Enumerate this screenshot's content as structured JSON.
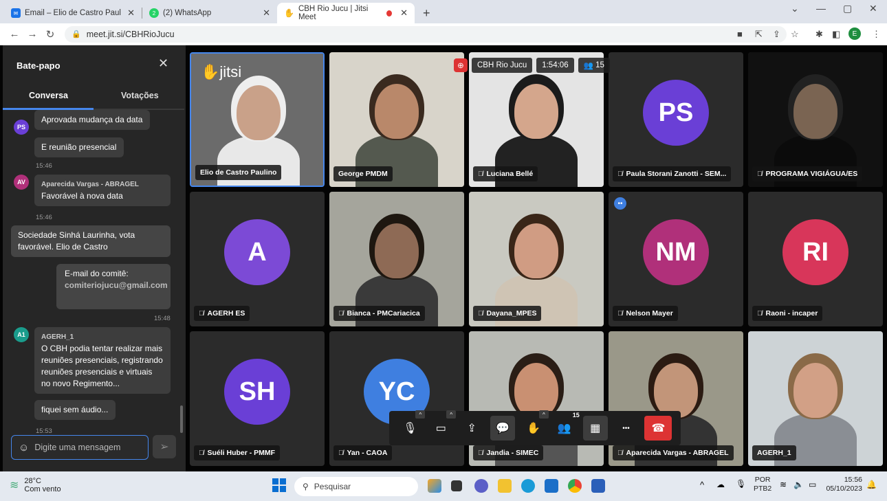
{
  "browser": {
    "tabs": [
      {
        "title": "Email – Elio de Castro Paulino -",
        "icon": "mail-icon"
      },
      {
        "title": "(2) WhatsApp",
        "icon": "whatsapp-icon"
      },
      {
        "title": "CBH Rio Jucu | Jitsi Meet",
        "icon": "jitsi-icon"
      }
    ],
    "url": "meet.jit.si/CBHRioJucu",
    "profile_initial": "E"
  },
  "chat": {
    "title": "Bate-papo",
    "tab_conversation": "Conversa",
    "tab_polls": "Votações",
    "messages": [
      {
        "initials": "PS",
        "text": "Aprovada mudança da data"
      },
      {
        "text": "E reunião presencial",
        "time": "15:46"
      },
      {
        "initials": "AV",
        "sender": "Aparecida Vargas - ABRAGEL",
        "text": "Favorável à nova data",
        "time": "15:46"
      },
      {
        "text": "Sociedade Sinhá Laurinha, vota favorável.  Elio de Castro"
      },
      {
        "text": "E-mail do comitê:",
        "text2": "comiteriojucu@gmail.com",
        "time": "15:48"
      },
      {
        "initials": "A1",
        "sender": "AGERH_1",
        "text": "O CBH podia tentar realizar mais reuniões presenciais, registrando reuniões presenciais e virtuais no novo Regimento..."
      },
      {
        "text": "fiquei sem áudio...",
        "time": "15:53"
      }
    ],
    "input_placeholder": "Digite uma mensagem"
  },
  "meeting": {
    "name": "CBH Rio Jucu",
    "duration": "1:54:06",
    "participant_count": "15",
    "logo": "jitsi"
  },
  "tiles": [
    {
      "name": "Elio de Castro Paulino",
      "video": true
    },
    {
      "name": "George PMDM",
      "video": true
    },
    {
      "name": "Luciana Bellé",
      "video": true,
      "muted": true
    },
    {
      "name": "Paula Storani Zanotti - SEM...",
      "initials": "PS",
      "color": "#6a3fd6",
      "muted": true
    },
    {
      "name": "PROGRAMA VIGIÁGUA/ES",
      "video": true,
      "muted": true
    },
    {
      "name": "AGERH ES",
      "initials": "A",
      "color": "#7c4ad6",
      "muted": true
    },
    {
      "name": "Bianca - PMCariacica",
      "video": true,
      "muted": true
    },
    {
      "name": "Dayana_MPES",
      "video": true,
      "muted": true
    },
    {
      "name": "Nelson Mayer",
      "initials": "NM",
      "color": "#b0307a",
      "muted": true
    },
    {
      "name": "Raoni - incaper",
      "initials": "RI",
      "color": "#d8365a",
      "muted": true
    },
    {
      "name": "Suéli Huber - PMMF",
      "initials": "SH",
      "color": "#6a3fd6",
      "muted": true
    },
    {
      "name": "Yan - CAOA",
      "initials": "YC",
      "color": "#3f7fe0",
      "muted": true
    },
    {
      "name": "Jandia - SIMEC",
      "video": true,
      "muted": true
    },
    {
      "name": "Aparecida Vargas - ABRAGEL",
      "video": true,
      "muted": true
    },
    {
      "name": "AGERH_1",
      "video": true
    }
  ],
  "toolbar": {
    "participants_badge": "15"
  },
  "taskbar": {
    "temperature": "28°C",
    "weather": "Com vento",
    "search": "Pesquisar",
    "lang": "POR",
    "layout": "PTB2",
    "time": "15:56",
    "date": "05/10/2023"
  }
}
